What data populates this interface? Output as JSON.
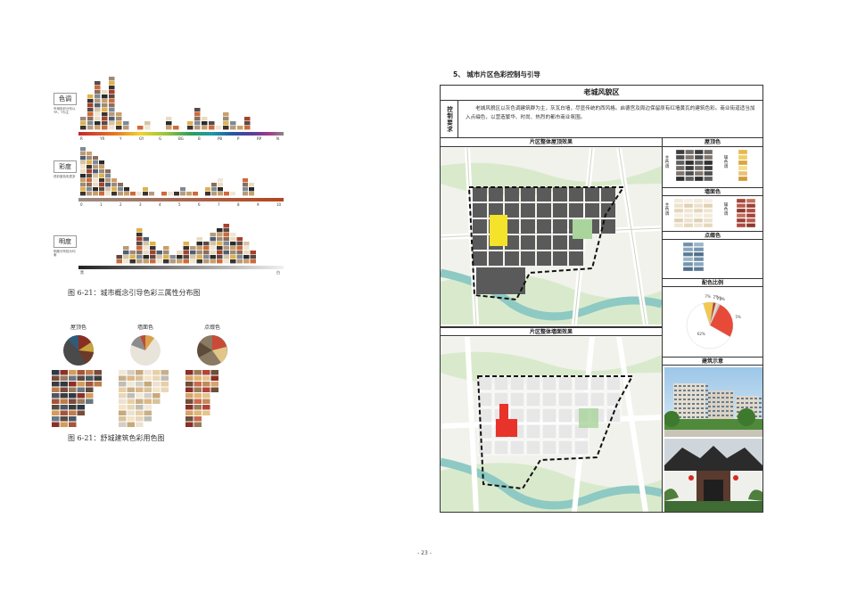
{
  "left_page": {
    "hue_chart": {
      "label": "色调",
      "desc": "市域色彩分布以YR、Y为主",
      "axis_labels": [
        "R",
        "YR",
        "Y",
        "GY",
        "G",
        "BG",
        "B",
        "PB",
        "P",
        "RP",
        "N"
      ]
    },
    "chroma_chart": {
      "label": "彩度",
      "desc": "低彩度色彩居多",
      "axis_labels": [
        "0",
        "1",
        "2",
        "3",
        "4",
        "5",
        "6",
        "7",
        "8",
        "9",
        "10"
      ]
    },
    "value_chart": {
      "label": "明度",
      "desc": "明度分布较为均衡",
      "axis_labels": [
        "黑",
        "",
        "",
        "",
        "",
        "",
        "",
        "",
        "",
        "白"
      ]
    },
    "figure1_caption": "图 6-21：城市概念引导色彩三属性分布图",
    "swatch_groups": [
      {
        "title": "屋顶色"
      },
      {
        "title": "墙面色"
      },
      {
        "title": "点缀色"
      }
    ],
    "figure2_caption": "图 6-21：舒城建筑色彩用色图"
  },
  "right_page": {
    "section_title": "5、 城市片区色彩控制与引导",
    "panel_title": "老城风貌区",
    "requirement_label": "控制要求",
    "requirement_text": "老城风貌区以灰色调建筑群为主，灰瓦白墙，尽显传统的西风格。启德宫及周边保留原有红墙黄瓦的建筑色彩。商业街道适当加入点缀色，以营造繁华、时尚、热烈的都市商业氛围。",
    "roof_map_title": "片区整体屋顶效果",
    "wall_map_title": "片区整体墙面效果",
    "roof_color_title": "屋顶色",
    "wall_color_title": "墙面色",
    "accent_color_title": "点缀色",
    "ratio_title": "配色比例",
    "building_title": "建筑示意",
    "main_tone_label": "主色调",
    "aux_tone_label": "辅色调",
    "pie_labels": [
      "7%",
      "2%",
      "2%",
      "1%",
      "5%",
      "62%"
    ],
    "pie_values": [
      7,
      2,
      2,
      1,
      26,
      62
    ]
  },
  "page_number": "- 23 -"
}
